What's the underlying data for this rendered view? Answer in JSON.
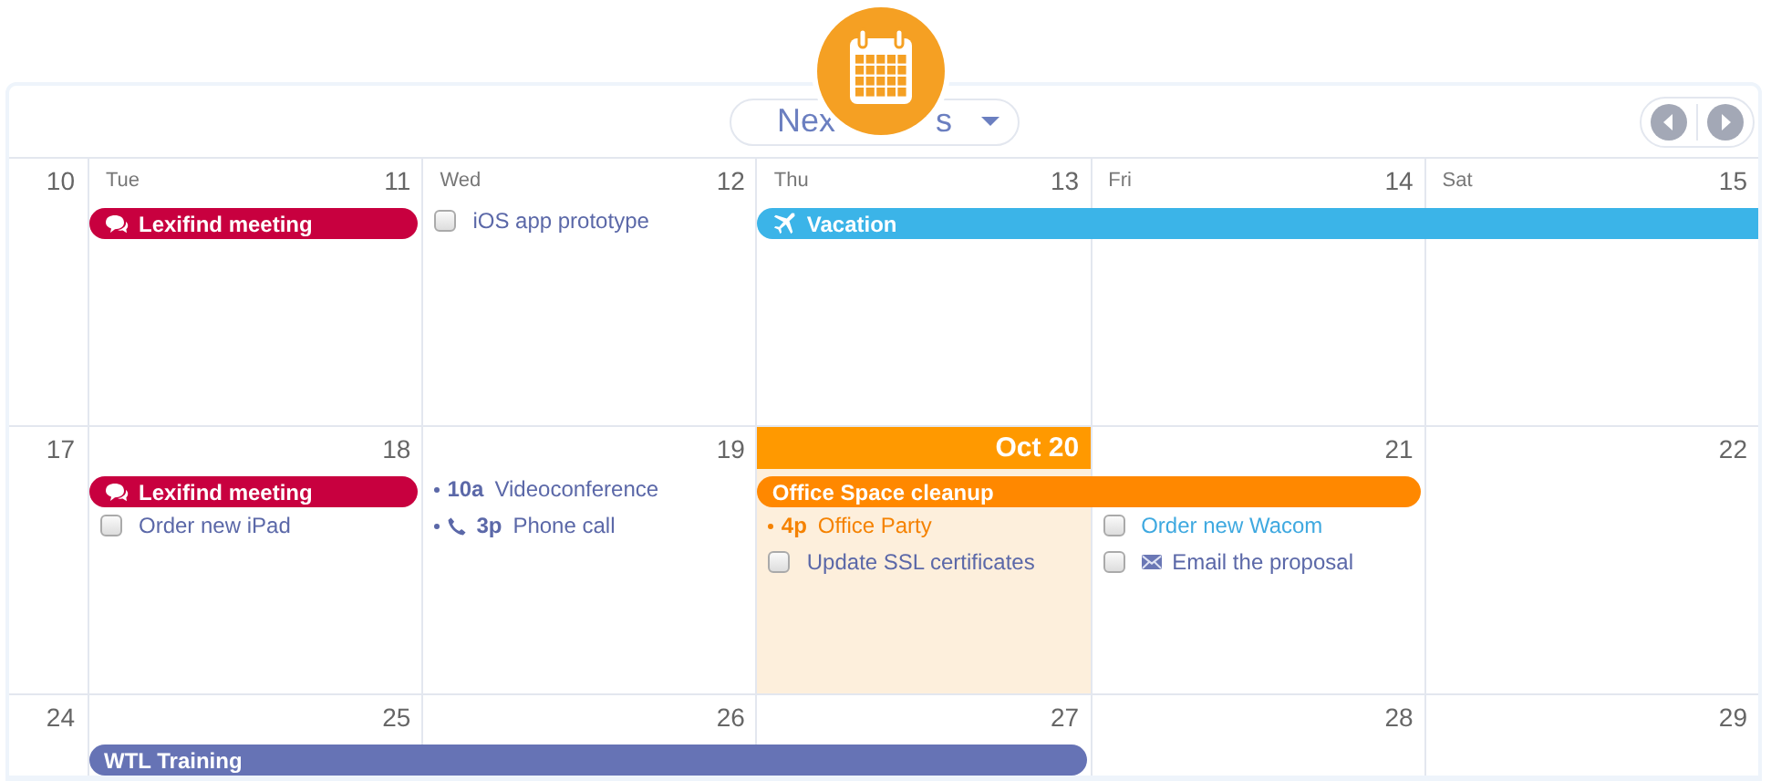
{
  "header": {
    "range_button": {
      "text_before": "Nex",
      "text_after": "s"
    }
  },
  "weeks": [
    {
      "number": "10",
      "days": [
        {
          "name": "Tue",
          "date": "11",
          "today": false,
          "bars": [
            {
              "starts": true,
              "ends": true,
              "title": "Lexifind meeting",
              "color": "#c8003f",
              "kind": "chat"
            }
          ]
        },
        {
          "name": "Wed",
          "date": "12",
          "today": false,
          "items": [
            {
              "kind": "task",
              "text": "iOS app prototype",
              "checked": false,
              "color": "#5b68a8"
            }
          ]
        },
        {
          "name": "Thu",
          "date": "13",
          "today": false,
          "bars": [
            {
              "starts": true,
              "ends": false,
              "title": "Vacation",
              "color": "#3bb4e8",
              "kind": "flight"
            }
          ]
        },
        {
          "name": "Fri",
          "date": "14",
          "today": false,
          "bars": [
            {
              "starts": false,
              "ends": false
            }
          ]
        },
        {
          "name": "Sat",
          "date": "15",
          "today": false,
          "bars": [
            {
              "starts": false,
              "ends": false
            }
          ]
        }
      ]
    },
    {
      "number": "17",
      "days": [
        {
          "date": "18",
          "today": false,
          "bars": [
            {
              "starts": true,
              "ends": true,
              "title": "Lexifind meeting",
              "color": "#c8003f",
              "kind": "chat"
            }
          ],
          "items": [
            {
              "kind": "task",
              "text": "Order new iPad",
              "checked": false,
              "color": "#5b68a8"
            }
          ]
        },
        {
          "date": "19",
          "today": false,
          "items": [
            {
              "kind": "timed",
              "time": "10a",
              "text": "Videoconference",
              "color": "#5b68a8"
            },
            {
              "kind": "call",
              "time": "3p",
              "text": "Phone call",
              "color": "#5b68a8"
            }
          ]
        },
        {
          "date": "Oct 20",
          "today": true,
          "bars": [
            {
              "starts": true,
              "ends": false,
              "title": "Office Space cleanup",
              "color": "#ff8800",
              "kind": "plain"
            }
          ],
          "items": [
            {
              "kind": "timed",
              "time": "4p",
              "text": "Office Party",
              "color": "#f58200"
            },
            {
              "kind": "task",
              "text": "Update SSL certificates",
              "checked": false,
              "color": "#5b68a8"
            }
          ]
        },
        {
          "date": "21",
          "today": false,
          "bars": [
            {
              "starts": false,
              "ends": true
            }
          ],
          "items": [
            {
              "kind": "task",
              "text": "Order new Wacom",
              "checked": false,
              "color": "#3fa9e0"
            },
            {
              "kind": "mail-task",
              "text": "Email the proposal",
              "checked": false,
              "color": "#5b68a8"
            }
          ]
        },
        {
          "date": "22",
          "today": false
        }
      ]
    },
    {
      "number": "24",
      "days": [
        {
          "date": "25",
          "today": false,
          "bars": [
            {
              "starts": true,
              "ends": false,
              "title": "WTL Training",
              "color": "#6673b5",
              "kind": "plain"
            }
          ]
        },
        {
          "date": "26",
          "today": false,
          "bars": [
            {
              "starts": false,
              "ends": false
            }
          ]
        },
        {
          "date": "27",
          "today": false,
          "bars": [
            {
              "starts": false,
              "ends": true
            }
          ]
        },
        {
          "date": "28",
          "today": false
        },
        {
          "date": "29",
          "today": false
        }
      ]
    }
  ]
}
